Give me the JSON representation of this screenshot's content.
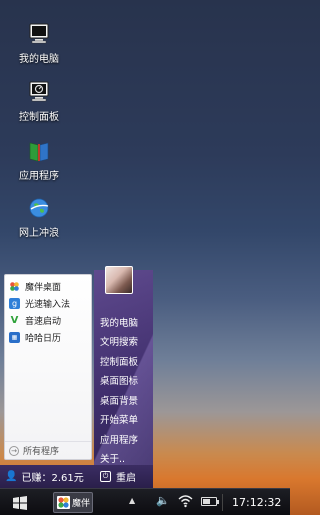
{
  "desktop": {
    "icons": [
      {
        "label": "我的电脑",
        "icon": "monitor-icon"
      },
      {
        "label": "控制面板",
        "icon": "control-panel-icon"
      },
      {
        "label": "应用程序",
        "icon": "apps-book-icon"
      },
      {
        "label": "网上冲浪",
        "icon": "globe-icon"
      }
    ]
  },
  "start_menu": {
    "left_items": [
      {
        "label": "魔伴桌面",
        "icon": "flower-icon",
        "color": "#e8553a"
      },
      {
        "label": "光速输入法",
        "icon": "keyboard-g-icon",
        "color": "#2f7fd8"
      },
      {
        "label": "音速启动",
        "icon": "v-launcher-icon",
        "color": "#2fa23a"
      },
      {
        "label": "哈哈日历",
        "icon": "calendar-icon",
        "color": "#2a6fc9"
      }
    ],
    "all_programs": "所有程序",
    "right_items": [
      "我的电脑",
      "文明搜索",
      "控制面板",
      "桌面图标",
      "桌面背景",
      "开始菜单",
      "应用程序",
      "关于.."
    ],
    "earned": "已赚：2.61元",
    "restart": "重启"
  },
  "taskbar": {
    "app_label": "魔伴",
    "clock": "17:12:32",
    "battery_level": 0.6
  }
}
